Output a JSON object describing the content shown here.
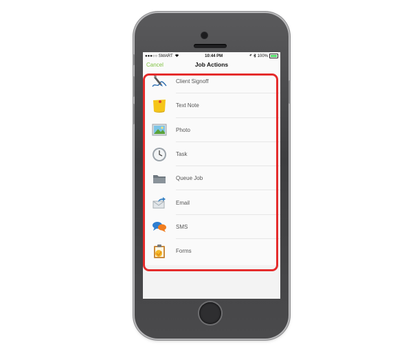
{
  "status_bar": {
    "carrier": "●●●○○ SMART",
    "time": "10:44 PM",
    "battery": "100%"
  },
  "nav": {
    "cancel_label": "Cancel",
    "title": "Job Actions"
  },
  "actions": [
    {
      "label": "Client Signoff",
      "icon": "signature-icon"
    },
    {
      "label": "Text Note",
      "icon": "sticky-note-icon"
    },
    {
      "label": "Photo",
      "icon": "photo-icon"
    },
    {
      "label": "Task",
      "icon": "clock-icon"
    },
    {
      "label": "Queue Job",
      "icon": "folder-icon"
    },
    {
      "label": "Email",
      "icon": "email-icon"
    },
    {
      "label": "SMS",
      "icon": "chat-bubbles-icon"
    },
    {
      "label": "Forms",
      "icon": "clipboard-icon"
    }
  ],
  "colors": {
    "accent": "#7fc241",
    "highlight": "#e52b2b"
  }
}
